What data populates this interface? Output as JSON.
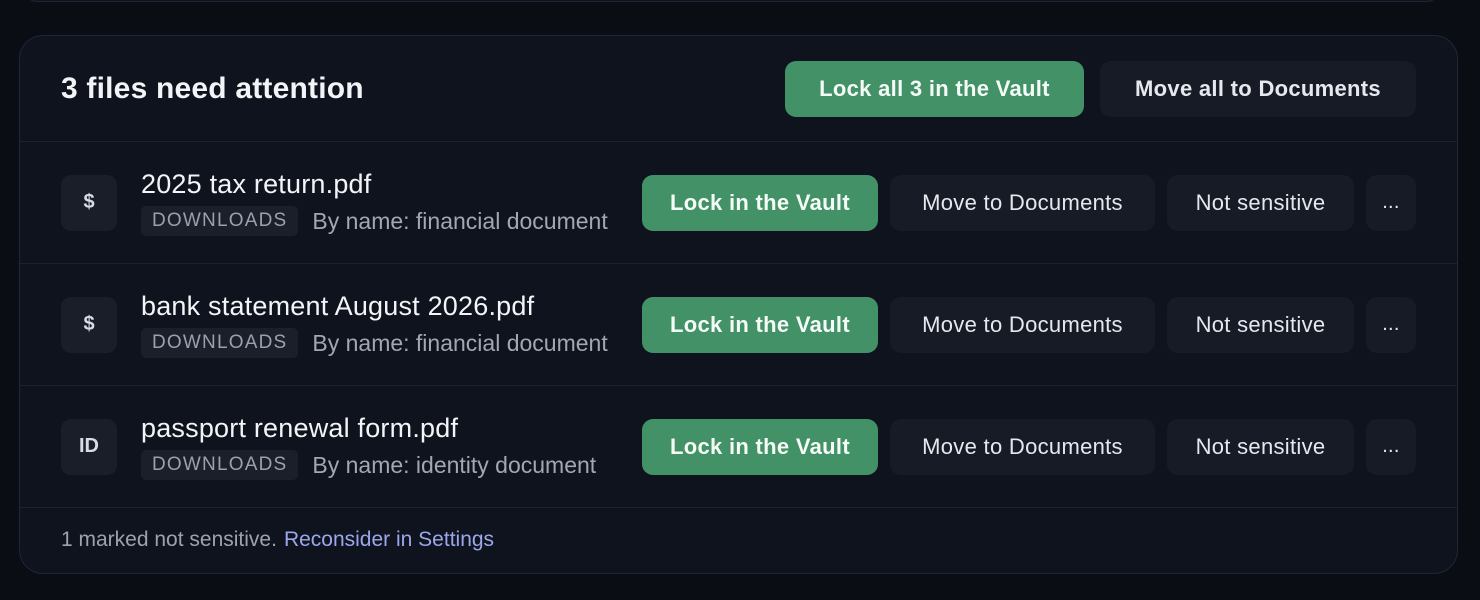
{
  "header": {
    "title": "3 files need attention",
    "lock_all_label": "Lock all 3 in the Vault",
    "move_all_label": "Move all to Documents"
  },
  "files": [
    {
      "icon": "$",
      "icon_name": "dollar-icon",
      "name": "2025 tax return.pdf",
      "location": "DOWNLOADS",
      "reason": "By name: financial document",
      "lock_label": "Lock in the Vault",
      "move_label": "Move to Documents",
      "not_sensitive_label": "Not sensitive",
      "more_label": "..."
    },
    {
      "icon": "$",
      "icon_name": "dollar-icon",
      "name": "bank statement August 2026.pdf",
      "location": "DOWNLOADS",
      "reason": "By name: financial document",
      "lock_label": "Lock in the Vault",
      "move_label": "Move to Documents",
      "not_sensitive_label": "Not sensitive",
      "more_label": "..."
    },
    {
      "icon": "ID",
      "icon_name": "id-card-icon",
      "name": "passport renewal form.pdf",
      "location": "DOWNLOADS",
      "reason": "By name: identity document",
      "lock_label": "Lock in the Vault",
      "move_label": "Move to Documents",
      "not_sensitive_label": "Not sensitive",
      "more_label": "..."
    }
  ],
  "footer": {
    "status_text": "1 marked not sensitive.",
    "link_text": "Reconsider in Settings"
  },
  "colors": {
    "accent_green": "#429167",
    "link_blue": "#9ba7ec",
    "panel_bg": "#0f131d"
  }
}
